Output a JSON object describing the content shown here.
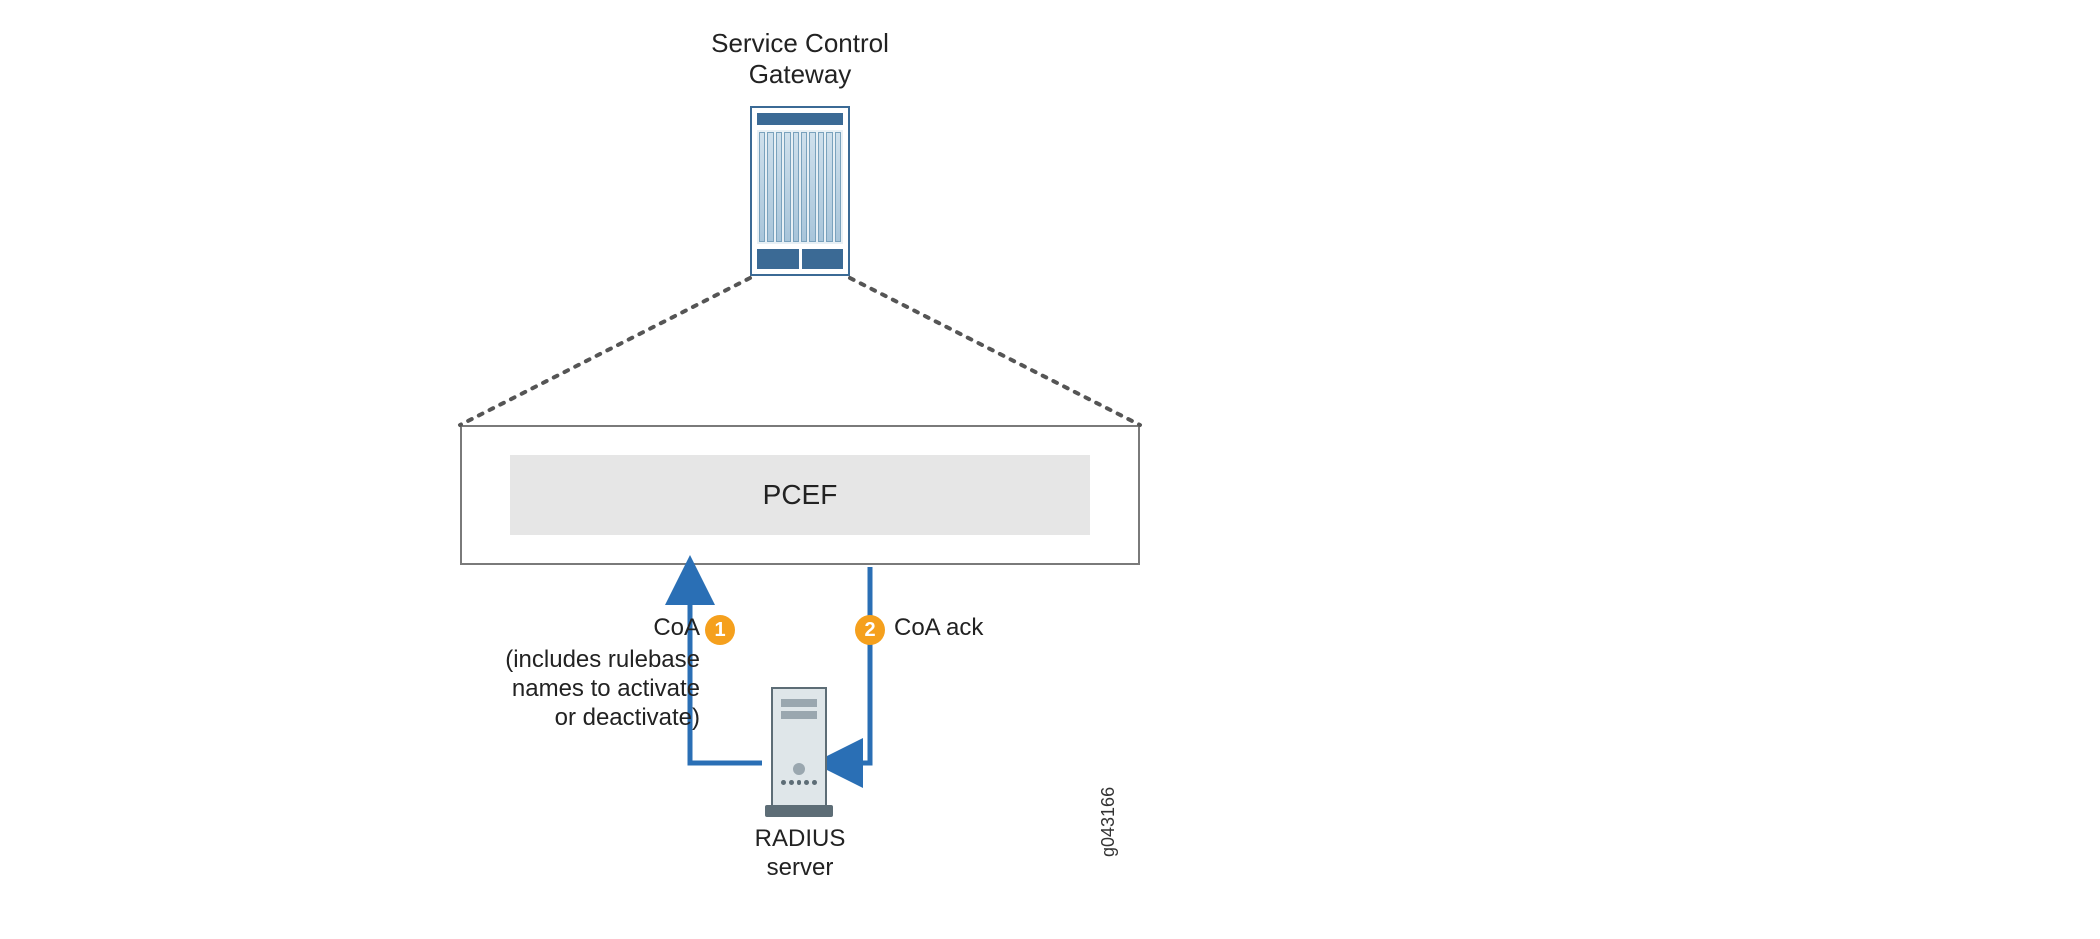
{
  "title": "Service Control\nGateway",
  "pcef": {
    "label": "PCEF"
  },
  "flow": {
    "coa": {
      "badge": "1",
      "label": "CoA",
      "note_line1": "(includes rulebase",
      "note_line2": "names to activate",
      "note_line3": "or deactivate)"
    },
    "coa_ack": {
      "badge": "2",
      "label": "CoA ack"
    }
  },
  "radius": {
    "label_line1": "RADIUS",
    "label_line2": "server"
  },
  "image_id": "g043166",
  "colors": {
    "arrow": "#2a6fb5",
    "dotted": "#555555",
    "badge": "#f5a01d",
    "outline": "#7a7a7a"
  }
}
